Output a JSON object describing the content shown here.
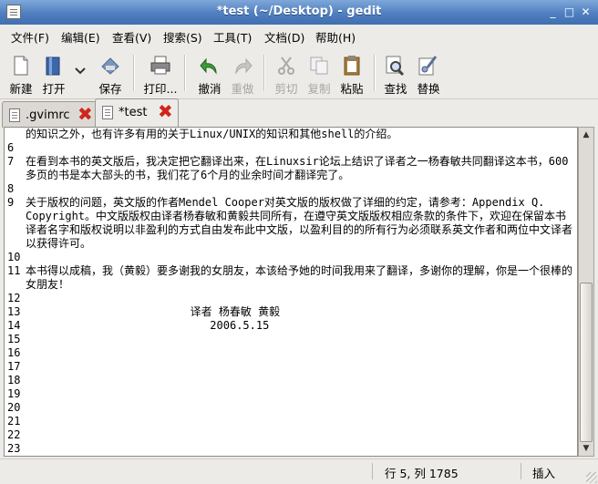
{
  "window": {
    "title": "*test (~/Desktop) - gedit",
    "minimize": "_",
    "maximize": "□",
    "close": "✕"
  },
  "menu": [
    {
      "label": "文件(F)"
    },
    {
      "label": "编辑(E)"
    },
    {
      "label": "查看(V)"
    },
    {
      "label": "搜索(S)"
    },
    {
      "label": "工具(T)"
    },
    {
      "label": "文档(D)"
    },
    {
      "label": "帮助(H)"
    }
  ],
  "toolbar": {
    "new": "新建",
    "open": "打开",
    "save": "保存",
    "print": "打印...",
    "undo": "撤消",
    "redo": "重做",
    "cut": "剪切",
    "copy": "复制",
    "paste": "粘贴",
    "find": "查找",
    "replace": "替换"
  },
  "tabs": [
    {
      "label": ".gvimrc",
      "close": "✖"
    },
    {
      "label": "*test",
      "close": "✖"
    }
  ],
  "lines": [
    {
      "n": "",
      "text": "的知识之外，也有许多有用的关于Linux/UNIX的知识和其他shell的介绍。"
    },
    {
      "n": "6",
      "text": ""
    },
    {
      "n": "7",
      "text": "在看到本书的英文版后，我决定把它翻译出来，在Linuxsir论坛上结识了译者之一杨春敏共同翻译这本书，600多页的书是本大部头的书，我们花了6个月的业余时间才翻译完了。"
    },
    {
      "n": "8",
      "text": ""
    },
    {
      "n": "9",
      "text": "关于版权的问题，英文版的作者Mendel Cooper对英文版的版权做了详细的约定，请参考：Appendix Q. Copyright。中文版版权由译者杨春敏和黄毅共同所有，在遵守英文版版权相应条款的条件下，欢迎在保留本书译者名字和版权说明以非盈利的方式自由发布此中文版，以盈利目的的所有行为必须联系英文作者和两位中文译者以获得许可。"
    },
    {
      "n": "10",
      "text": ""
    },
    {
      "n": "11",
      "text": "本书得以成稿，我（黄毅）要多谢我的女朋友，本该给予她的时间我用来了翻译，多谢你的理解，你是一个很棒的女朋友！"
    },
    {
      "n": "12",
      "text": ""
    },
    {
      "n": "13",
      "text": "                         译者 杨春敏 黄毅"
    },
    {
      "n": "14",
      "text": "                            2006.5.15"
    },
    {
      "n": "15",
      "text": ""
    },
    {
      "n": "16",
      "text": ""
    },
    {
      "n": "17",
      "text": ""
    },
    {
      "n": "18",
      "text": ""
    },
    {
      "n": "19",
      "text": ""
    },
    {
      "n": "20",
      "text": ""
    },
    {
      "n": "21",
      "text": ""
    },
    {
      "n": "22",
      "text": ""
    },
    {
      "n": "23",
      "text": ""
    }
  ],
  "status": {
    "position": "行 5, 列 1785",
    "mode": "插入"
  }
}
